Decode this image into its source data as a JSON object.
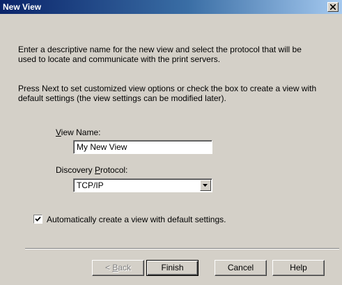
{
  "window": {
    "title": "New View"
  },
  "intro": {
    "line1": "Enter a descriptive name for the new view and select the protocol that will be",
    "line2": "used to locate and communicate with the print servers.",
    "line3": "Press Next to set customized view options or check the box to create a view with",
    "line4": " default settings (the view settings can be modified later)."
  },
  "view_name": {
    "label_mnemonic": "V",
    "label_rest": "iew Name:",
    "value": "My New View"
  },
  "protocol": {
    "label_pre": "Discovery ",
    "label_mnemonic": "P",
    "label_rest": "rotocol:",
    "selected": "TCP/IP"
  },
  "auto_create": {
    "checked": true,
    "label": "Automatically create a view with default settings."
  },
  "buttons": {
    "back_pre": "< ",
    "back_mnemonic": "B",
    "back_rest": "ack",
    "finish": "Finish",
    "cancel": "Cancel",
    "help": "Help"
  }
}
